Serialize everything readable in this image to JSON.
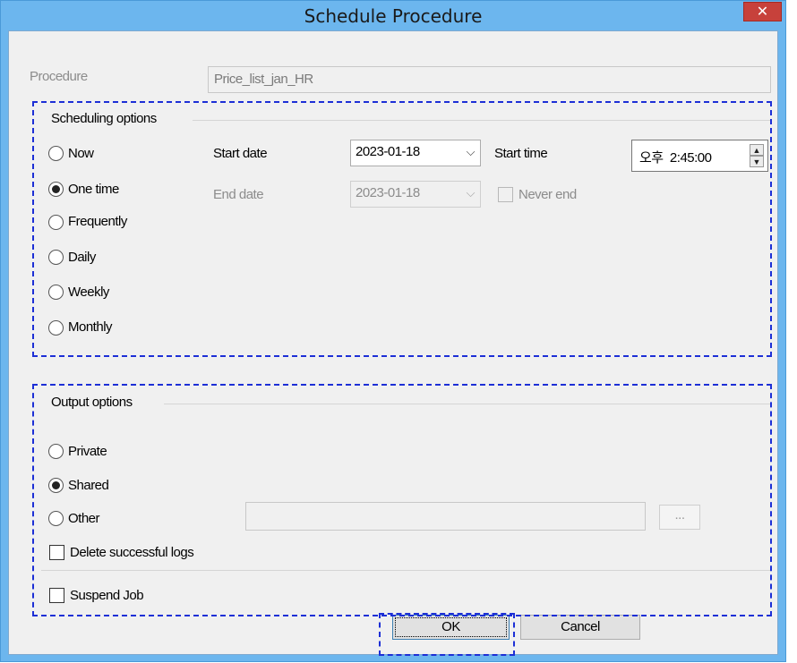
{
  "window": {
    "title": "Schedule Procedure",
    "close_glyph": "✕"
  },
  "procedure": {
    "label": "Procedure",
    "value": "Price_list_jan_HR"
  },
  "scheduling": {
    "title": "Scheduling options",
    "options": [
      {
        "label": "Now",
        "checked": false
      },
      {
        "label": "One time",
        "checked": true
      },
      {
        "label": "Frequently",
        "checked": false
      },
      {
        "label": "Daily",
        "checked": false
      },
      {
        "label": "Weekly",
        "checked": false
      },
      {
        "label": "Monthly",
        "checked": false
      }
    ],
    "start_date_label": "Start date",
    "start_date_value": "2023-01-18",
    "end_date_label": "End date",
    "end_date_value": "2023-01-18",
    "start_time_label": "Start time",
    "start_time_value": "오후  2:45:00",
    "never_end_label": "Never end",
    "chevron_glyph": "⌵",
    "spin_up_glyph": "▲",
    "spin_down_glyph": "▼"
  },
  "output": {
    "title": "Output options",
    "options": [
      {
        "label": "Private",
        "checked": false
      },
      {
        "label": "Shared",
        "checked": true
      },
      {
        "label": "Other",
        "checked": false
      }
    ],
    "browse_label": "...",
    "delete_logs_label": "Delete successful logs",
    "suspend_job_label": "Suspend Job"
  },
  "buttons": {
    "ok": "OK",
    "cancel": "Cancel"
  },
  "colors": {
    "titlebar": "#6cb6ee",
    "close_button": "#c7413b",
    "highlight_dash": "#1d2fd6",
    "dialog_bg": "#f0f0f0"
  }
}
